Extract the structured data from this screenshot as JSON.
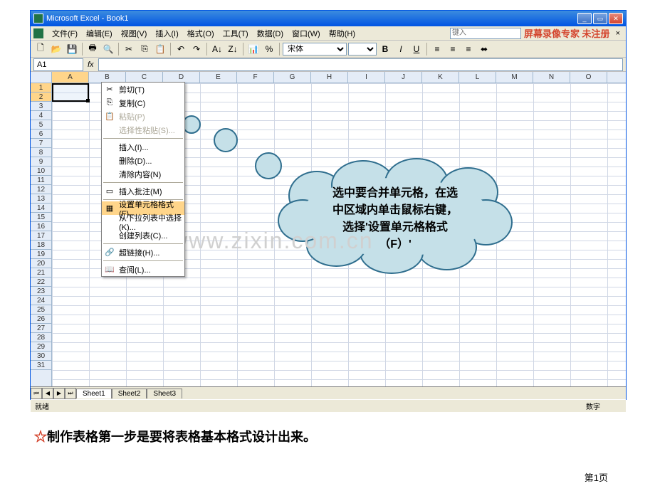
{
  "titlebar": {
    "title": "Microsoft Excel - Book1"
  },
  "menubar": {
    "items": [
      "文件(F)",
      "编辑(E)",
      "视图(V)",
      "插入(I)",
      "格式(O)",
      "工具(T)",
      "数据(D)",
      "窗口(W)",
      "帮助(H)"
    ],
    "help_placeholder": "键入",
    "watermark_text": "屏幕录像专家 未注册",
    "doc_close": "×"
  },
  "toolbar": {
    "font_name": "宋体",
    "font_size": "",
    "bold": "B",
    "italic": "I",
    "underline": "U"
  },
  "namebox": {
    "cell_ref": "A1",
    "fx": "fx"
  },
  "columns": [
    "A",
    "B",
    "C",
    "D",
    "E",
    "F",
    "G",
    "H",
    "I",
    "J",
    "K",
    "L",
    "M",
    "N",
    "O"
  ],
  "rows": [
    "1",
    "2",
    "3",
    "4",
    "5",
    "6",
    "7",
    "8",
    "9",
    "10",
    "11",
    "12",
    "13",
    "14",
    "15",
    "16",
    "17",
    "18",
    "19",
    "20",
    "21",
    "22",
    "23",
    "24",
    "25",
    "26",
    "27",
    "28",
    "29",
    "30",
    "31"
  ],
  "context_menu": {
    "items": [
      {
        "label": "剪切(T)",
        "icon": "✂"
      },
      {
        "label": "复制(C)",
        "icon": "⎘"
      },
      {
        "label": "粘贴(P)",
        "icon": "📋",
        "disabled": true
      },
      {
        "label": "选择性粘贴(S)...",
        "disabled": true
      },
      {
        "sep": true
      },
      {
        "label": "插入(I)..."
      },
      {
        "label": "删除(D)..."
      },
      {
        "label": "清除内容(N)"
      },
      {
        "sep": true
      },
      {
        "label": "插入批注(M)",
        "icon": "▭"
      },
      {
        "sep": true
      },
      {
        "label": "设置单元格格式(F)...",
        "icon": "▦",
        "highlighted": true
      },
      {
        "label": "从下拉列表中选择(K)..."
      },
      {
        "label": "创建列表(C)..."
      },
      {
        "sep": true
      },
      {
        "label": "超链接(H)...",
        "icon": "🔗"
      },
      {
        "sep": true
      },
      {
        "label": "查阅(L)...",
        "icon": "📖"
      }
    ]
  },
  "sheets": {
    "tabs": [
      "Sheet1",
      "Sheet2",
      "Sheet3"
    ],
    "nav": [
      "⏮",
      "◀",
      "▶",
      "⏭"
    ]
  },
  "status": {
    "left": "就绪",
    "right": "数字"
  },
  "cloud": {
    "line1": "选中要合并单元格，在选",
    "line2": "中区域内单击鼠标右键，",
    "line3": "选择'设置单元格格式",
    "line4": "（F）'"
  },
  "watermark": "www.zixin.com.cn",
  "caption": {
    "star": "☆",
    "text": "制作表格第一步是要将表格基本格式设计出来。"
  },
  "pagenum": "第1页"
}
